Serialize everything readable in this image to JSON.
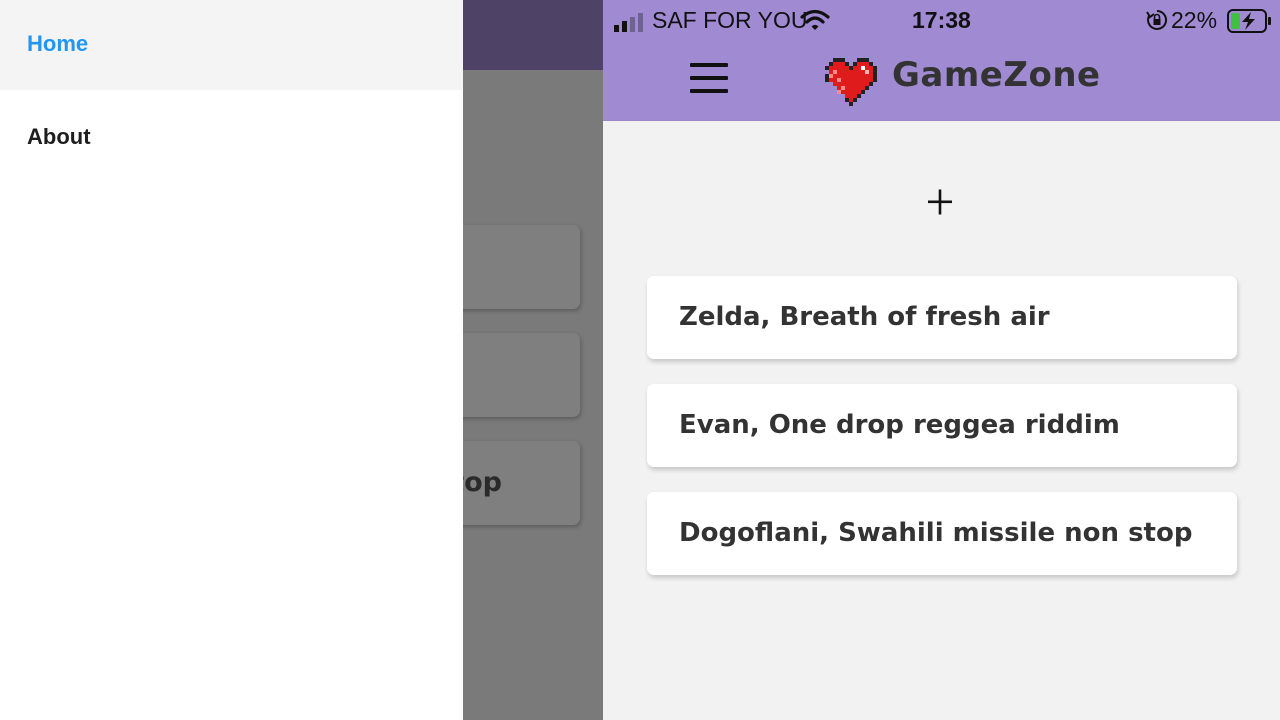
{
  "drawer": {
    "items": [
      {
        "label": "Home",
        "active": true
      },
      {
        "label": "About",
        "active": false
      }
    ]
  },
  "underlay": {
    "visible_card_fragments": [
      "",
      "",
      "top"
    ]
  },
  "statusbar": {
    "carrier": "SAF FOR YOU",
    "time": "17:38",
    "battery": "22%",
    "icons": [
      "signal-icon",
      "wifi-icon",
      "rotation-lock-icon",
      "battery-charging-icon"
    ]
  },
  "header": {
    "title": "GameZone",
    "logo": "pixel-heart-icon",
    "menu_icon": "hamburger-icon"
  },
  "main": {
    "add_icon": "plus-icon",
    "reviews": [
      {
        "title": "Zelda, Breath of fresh air"
      },
      {
        "title": "Evan, One drop reggea riddim"
      },
      {
        "title": "Dogoflani, Swahili missile non stop"
      }
    ]
  },
  "colors": {
    "header_bg": "#a08bd3",
    "drawer_active": "#2196f3",
    "dimmed_header": "#4e4366",
    "overlay": "#7a7a7a",
    "app_bg": "#f2f2f2"
  }
}
